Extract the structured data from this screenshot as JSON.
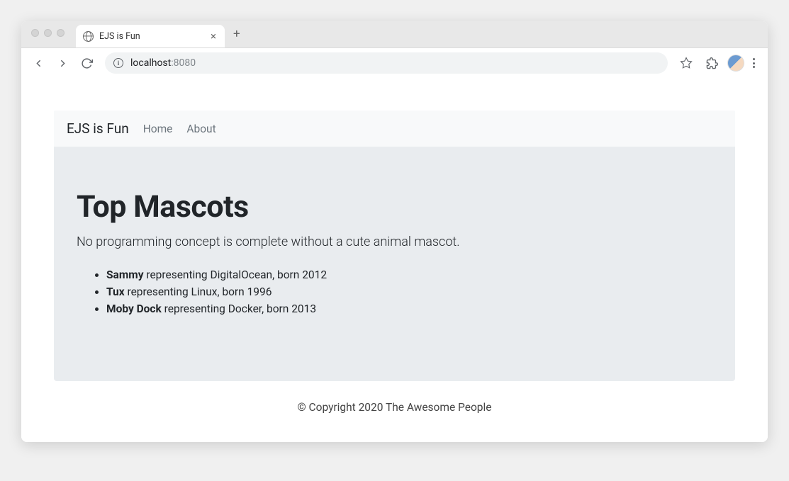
{
  "browser": {
    "tab_title": "EJS is Fun",
    "url_host": "localhost",
    "url_port": ":8080"
  },
  "navbar": {
    "brand": "EJS is Fun",
    "links": [
      "Home",
      "About"
    ]
  },
  "jumbotron": {
    "heading": "Top Mascots",
    "lead": "No programming concept is complete without a cute animal mascot."
  },
  "mascots": [
    {
      "name": "Sammy",
      "org": "DigitalOcean",
      "year": "2012"
    },
    {
      "name": "Tux",
      "org": "Linux",
      "year": "1996"
    },
    {
      "name": "Moby Dock",
      "org": "Docker",
      "year": "2013"
    }
  ],
  "footer": {
    "text": "© Copyright 2020 The Awesome People"
  }
}
